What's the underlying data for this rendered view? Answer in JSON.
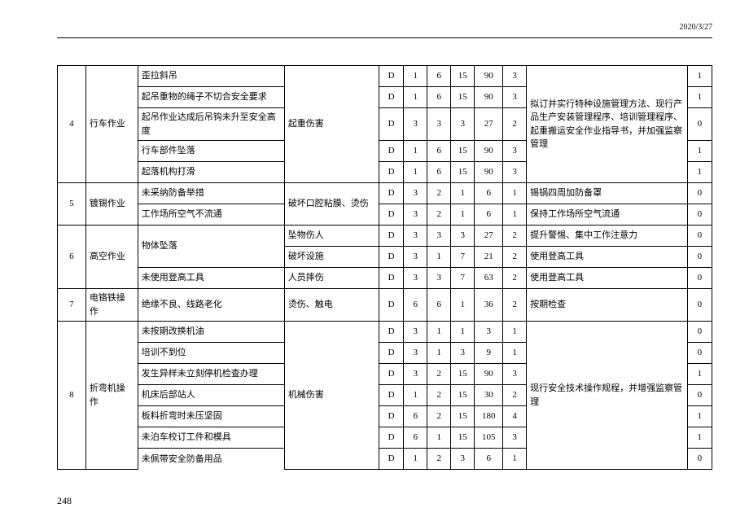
{
  "header_date": "2020/3/27",
  "page_number": "248",
  "groups": [
    {
      "num": "4",
      "operation": "行车作业",
      "measure": "拟订并实行特种设施管理方法、现行产品生产安装管理程序、培训管理程序、起重搬运安全作业指导书，并加强监察管理",
      "rows": [
        {
          "hazard": "歪拉斜吊",
          "harm": "起重伤害",
          "d": "D",
          "n1": "1",
          "n2": "6",
          "n3": "15",
          "n4": "90",
          "n5": "3",
          "last": "1",
          "harm_span": 5
        },
        {
          "hazard": "起吊重物的绳子不切合安全要求",
          "d": "D",
          "n1": "1",
          "n2": "6",
          "n3": "15",
          "n4": "90",
          "n5": "3",
          "last": "1"
        },
        {
          "hazard": "起吊作业达成后吊钩未升至安全高度",
          "d": "D",
          "n1": "3",
          "n2": "3",
          "n3": "3",
          "n4": "27",
          "n5": "2",
          "last": "0"
        },
        {
          "hazard": "行车部件坠落",
          "d": "D",
          "n1": "1",
          "n2": "6",
          "n3": "15",
          "n4": "90",
          "n5": "3",
          "last": "1"
        },
        {
          "hazard": "起落机构打滑",
          "d": "D",
          "n1": "1",
          "n2": "6",
          "n3": "15",
          "n4": "90",
          "n5": "3",
          "last": "1"
        }
      ]
    },
    {
      "num": "5",
      "operation": "镀锡作业",
      "rows": [
        {
          "hazard": "未采纳防备举措",
          "harm": "破坏口腔粘膜、烫伤",
          "d": "D",
          "n1": "3",
          "n2": "2",
          "n3": "1",
          "n4": "6",
          "n5": "1",
          "measure": "锡锅四周加防备罩",
          "last": "0",
          "harm_span": 2
        },
        {
          "hazard": "工作场所空气不流通",
          "d": "D",
          "n1": "3",
          "n2": "2",
          "n3": "1",
          "n4": "6",
          "n5": "1",
          "measure": "保持工作场所空气流通",
          "last": "0"
        }
      ]
    },
    {
      "num": "6",
      "operation": "高空作业",
      "rows": [
        {
          "hazard": "物体坠落",
          "harm": "坠物伤人",
          "d": "D",
          "n1": "3",
          "n2": "3",
          "n3": "3",
          "n4": "27",
          "n5": "2",
          "measure": "提升警惕、集中工作注意力",
          "last": "0",
          "hazard_span": 2
        },
        {
          "harm": "破坏设施",
          "d": "D",
          "n1": "3",
          "n2": "1",
          "n3": "7",
          "n4": "21",
          "n5": "2",
          "measure": "使用登高工具",
          "last": "0"
        },
        {
          "hazard": "未使用登高工具",
          "harm": "人员摔伤",
          "d": "D",
          "n1": "3",
          "n2": "3",
          "n3": "7",
          "n4": "63",
          "n5": "2",
          "measure": "使用登高工具",
          "last": "0"
        }
      ]
    },
    {
      "num": "7",
      "operation": "电铬铁操作",
      "rows": [
        {
          "hazard": "绝缘不良、线路老化",
          "harm": "烫伤、触电",
          "d": "D",
          "n1": "6",
          "n2": "6",
          "n3": "1",
          "n4": "36",
          "n5": "2",
          "measure": "按期检查",
          "last": "0"
        }
      ]
    },
    {
      "num": "8",
      "operation": "折弯机操作",
      "measure": "现行安全技术操作规程，并增强监察管理",
      "harm": "机械伤害",
      "rows": [
        {
          "hazard": "未按期改换机油",
          "d": "D",
          "n1": "3",
          "n2": "1",
          "n3": "1",
          "n4": "3",
          "n5": "1",
          "last": "0"
        },
        {
          "hazard": "培训不到位",
          "d": "D",
          "n1": "3",
          "n2": "1",
          "n3": "3",
          "n4": "9",
          "n5": "1",
          "last": "0"
        },
        {
          "hazard": "发生异样未立刻停机检查办理",
          "d": "D",
          "n1": "3",
          "n2": "2",
          "n3": "15",
          "n4": "90",
          "n5": "3",
          "last": "1"
        },
        {
          "hazard": "机床后部站人",
          "d": "D",
          "n1": "1",
          "n2": "2",
          "n3": "15",
          "n4": "30",
          "n5": "2",
          "last": "0"
        },
        {
          "hazard": "板料折弯时未压坚固",
          "d": "D",
          "n1": "6",
          "n2": "2",
          "n3": "15",
          "n4": "180",
          "n5": "4",
          "last": "1"
        },
        {
          "hazard": "未泊车校订工件和模具",
          "d": "D",
          "n1": "6",
          "n2": "1",
          "n3": "15",
          "n4": "105",
          "n5": "3",
          "last": "1"
        },
        {
          "hazard": "未佩带安全防备用品",
          "d": "D",
          "n1": "1",
          "n2": "2",
          "n3": "3",
          "n4": "6",
          "n5": "1",
          "last": "0",
          "no_bottom": true
        }
      ]
    }
  ]
}
